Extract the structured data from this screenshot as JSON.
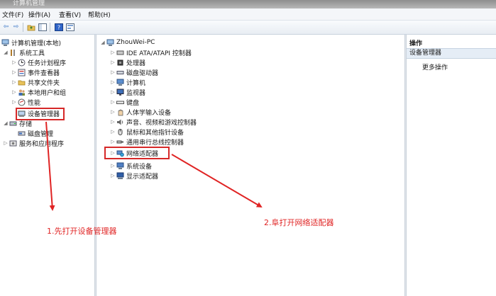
{
  "window": {
    "title": "计算机管理"
  },
  "menu": [
    {
      "label": "文件(F)"
    },
    {
      "label": "操作(A)"
    },
    {
      "label": "查看(V)"
    },
    {
      "label": "帮助(H)"
    }
  ],
  "toolbar": {
    "icons": [
      "back-arrow-icon",
      "forward-arrow-icon",
      "up-folder-icon",
      "show-hide-tree-icon",
      "help-icon",
      "properties-icon"
    ]
  },
  "left_tree": {
    "root": "计算机管理(本地)",
    "system_tools": "系统工具",
    "task_scheduler": "任务计划程序",
    "event_viewer": "事件查看器",
    "shared_folders": "共享文件夹",
    "local_users": "本地用户和组",
    "performance": "性能",
    "device_manager": "设备管理器",
    "storage": "存储",
    "disk_management": "磁盘管理",
    "services_apps": "服务和应用程序"
  },
  "device_tree": {
    "computer": "ZhouWei-PC",
    "categories": [
      "IDE ATA/ATAPI 控制器",
      "处理器",
      "磁盘驱动器",
      "计算机",
      "监视器",
      "键盘",
      "人体学输入设备",
      "声音、视频和游戏控制器",
      "鼠标和其他指针设备",
      "通用串行总线控制器",
      "网络适配器",
      "系统设备",
      "显示适配器"
    ]
  },
  "actions": {
    "header": "操作",
    "section": "设备管理器",
    "more": "更多操作"
  },
  "annotations": {
    "step1": "1.先打开设备管理器",
    "step2": "2.阜打开网络适配器"
  },
  "colors": {
    "annotation_red": "#e02424"
  }
}
